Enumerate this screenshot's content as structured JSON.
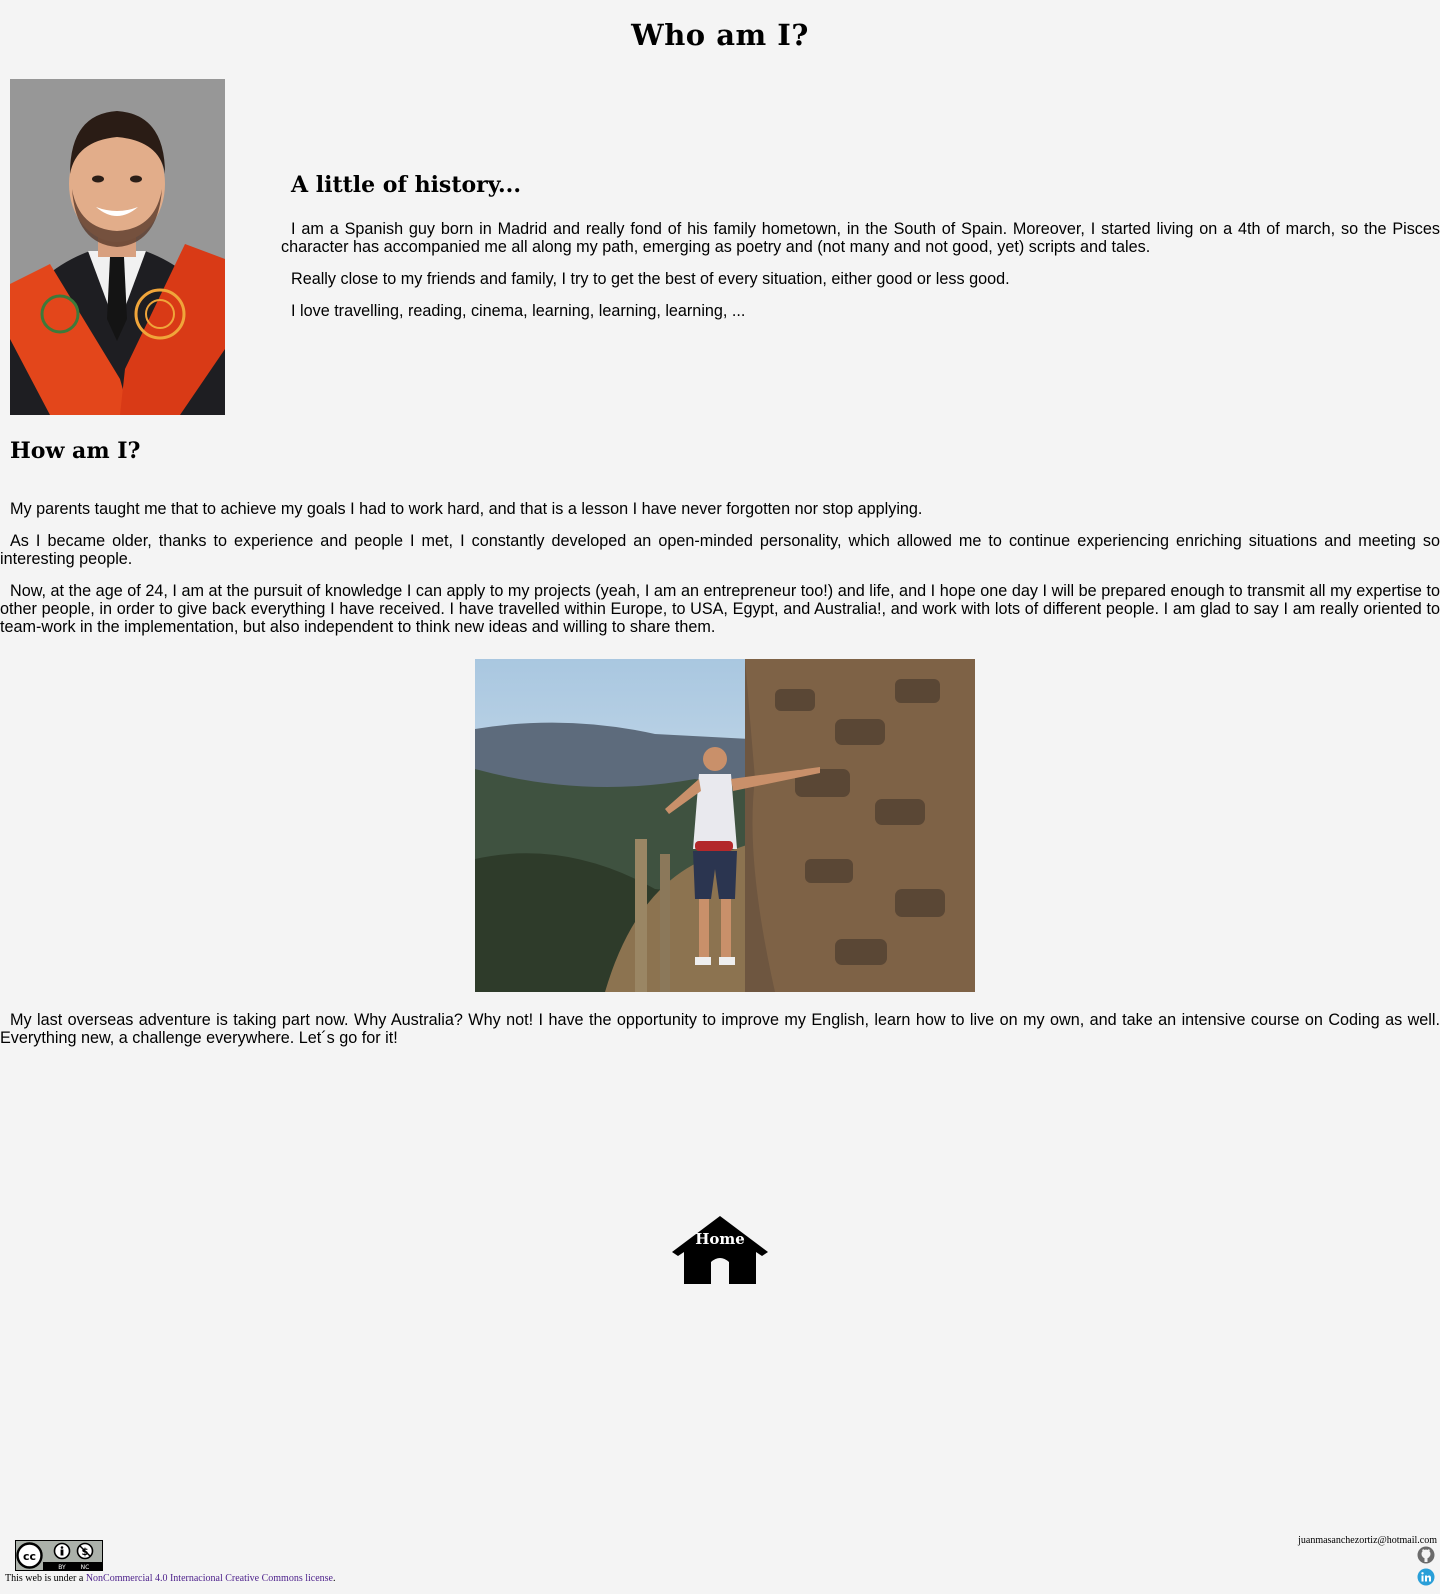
{
  "page": {
    "title": "Who am I?"
  },
  "history": {
    "heading": "A little of history...",
    "paragraphs": [
      "I am a Spanish guy born in Madrid and really fond of his family hometown, in the South of Spain. Moreover, I started living on a 4th of march, so the Pisces character has accompanied me all along my path, emerging as poetry and (not many and not good, yet) scripts and tales.",
      "Really close to my friends and family, I try to get the best of every situation, either good or less good.",
      "I love travelling, reading, cinema, learning, learning, learning, ..."
    ]
  },
  "how": {
    "heading": "How am I?",
    "paragraphs": [
      "My parents taught me that to achieve my goals I had to work hard, and that is a lesson I have never forgotten nor stop applying.",
      "As I became older, thanks to experience and people I met, I constantly developed an open-minded personality, which allowed me to continue experiencing enriching situations and meeting so interesting people.",
      "Now, at the age of 24, I am at the pursuit of knowledge I can apply to my projects (yeah, I am an entrepreneur too!) and life, and I hope one day I will be prepared enough to transmit all my expertise to other people, in order to give back everything I have received. I have travelled within Europe, to USA, Egypt, and Australia!, and work with lots of different people. I am glad to say I am really oriented to team-work in the implementation, but also independent to think new ideas and willing to share them."
    ],
    "last_paragraph": "My last overseas adventure is taking part now. Why Australia? Why not! I have the opportunity to improve my English, learn how to live on my own, and take an intensive course on Coding as well. Everything new, a challenge everywhere. Let´s go for it!"
  },
  "nav": {
    "home_label": "Home",
    "home_icon": "house-icon"
  },
  "footer": {
    "cc_badge": {
      "cc": "cc",
      "by": "BY",
      "nc": "NC"
    },
    "license_prefix": "This web is under a ",
    "license_link": "NonCommercial 4.0 Internacional Creative Commons license",
    "license_suffix": ".",
    "email": "juanmasanchezortiz@hotmail.com",
    "social_icons": [
      "github-icon",
      "linkedin-icon"
    ]
  },
  "colors": {
    "background": "#f4f4f4",
    "license_link": "#4b1f8a",
    "linkedin": "#2a9fd8",
    "github": "#6b6b6b",
    "sash": "#e3461b"
  }
}
